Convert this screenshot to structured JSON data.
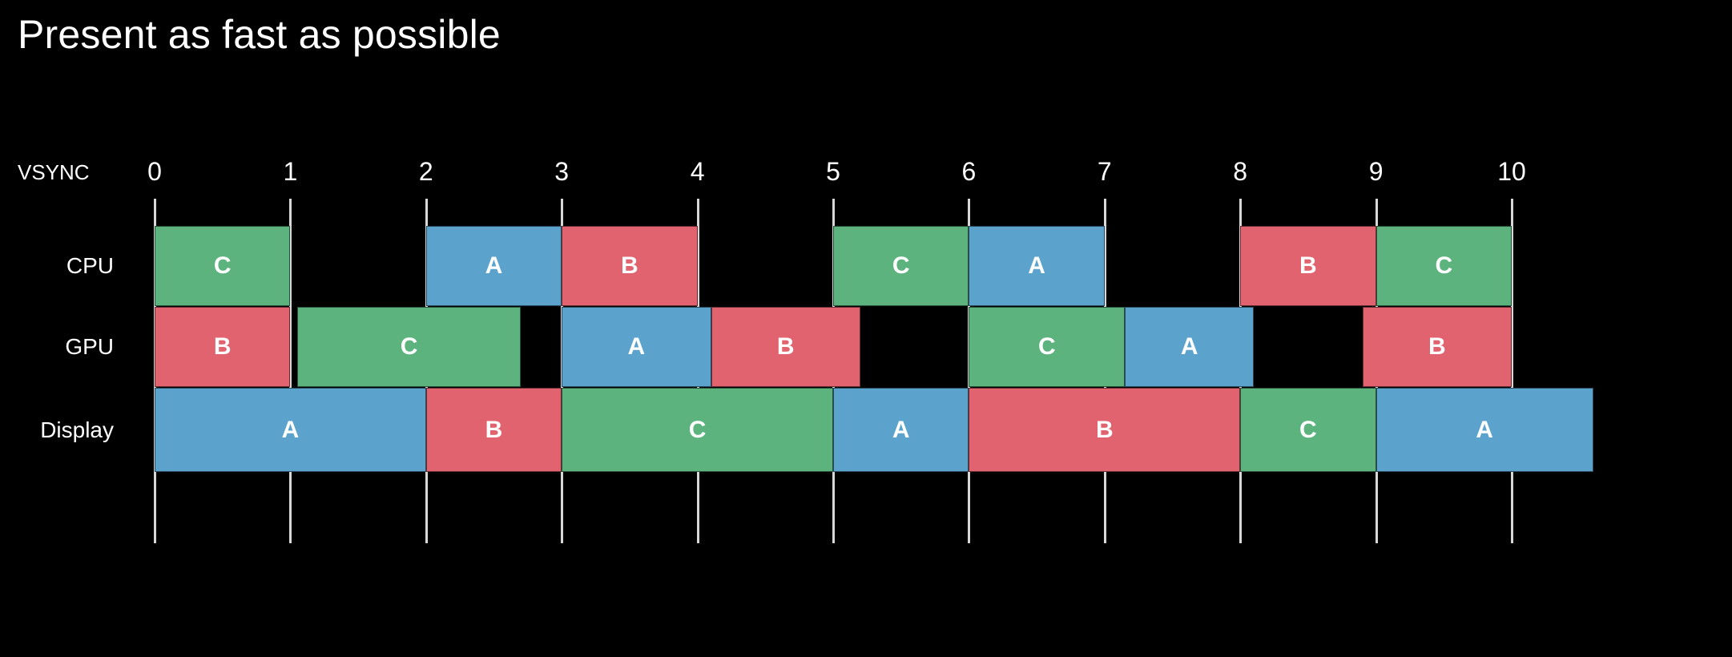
{
  "slide": {
    "title": "Present as fast as possible",
    "background_color": "#000000",
    "text_color": "#ffffff"
  },
  "axis": {
    "caption": "VSYNC",
    "ticks": [
      "0",
      "1",
      "2",
      "3",
      "4",
      "5",
      "6",
      "7",
      "8",
      "9",
      "10"
    ]
  },
  "colors": {
    "frame_a": "#5BA3CC",
    "frame_b": "#E0636F",
    "frame_c": "#5CB37E",
    "tick": "#d8d8d8"
  },
  "rows": [
    {
      "label": "CPU"
    },
    {
      "label": "GPU"
    },
    {
      "label": "Display"
    }
  ],
  "chart_data": {
    "type": "bar",
    "title": "Present as fast as possible",
    "xlabel": "VSYNC",
    "ylabel": "",
    "xlim": [
      0,
      10
    ],
    "categories": [
      "CPU",
      "GPU",
      "Display"
    ],
    "tick_labels": [
      "0",
      "1",
      "2",
      "3",
      "4",
      "5",
      "6",
      "7",
      "8",
      "9",
      "10"
    ],
    "grid": false,
    "legend": "none",
    "series": [
      {
        "name": "CPU",
        "bars": [
          {
            "label": "C",
            "start": 0.0,
            "end": 1.0,
            "color": "#5CB37E"
          },
          {
            "label": "A",
            "start": 2.0,
            "end": 3.0,
            "color": "#5BA3CC"
          },
          {
            "label": "B",
            "start": 3.0,
            "end": 4.0,
            "color": "#E0636F"
          },
          {
            "label": "C",
            "start": 5.0,
            "end": 6.0,
            "color": "#5CB37E"
          },
          {
            "label": "A",
            "start": 6.0,
            "end": 7.0,
            "color": "#5BA3CC"
          },
          {
            "label": "B",
            "start": 8.0,
            "end": 9.0,
            "color": "#E0636F"
          },
          {
            "label": "C",
            "start": 9.0,
            "end": 10.0,
            "color": "#5CB37E"
          }
        ]
      },
      {
        "name": "GPU",
        "bars": [
          {
            "label": "B",
            "start": 0.0,
            "end": 1.0,
            "color": "#E0636F"
          },
          {
            "label": "C",
            "start": 1.05,
            "end": 2.7,
            "color": "#5CB37E"
          },
          {
            "label": "A",
            "start": 3.0,
            "end": 4.1,
            "color": "#5BA3CC"
          },
          {
            "label": "B",
            "start": 4.1,
            "end": 5.2,
            "color": "#E0636F"
          },
          {
            "label": "C",
            "start": 6.0,
            "end": 7.15,
            "color": "#5CB37E"
          },
          {
            "label": "A",
            "start": 7.15,
            "end": 8.1,
            "color": "#5BA3CC"
          },
          {
            "label": "B",
            "start": 8.9,
            "end": 10.0,
            "color": "#E0636F"
          }
        ]
      },
      {
        "name": "Display",
        "bars": [
          {
            "label": "A",
            "start": 0.0,
            "end": 2.0,
            "color": "#5BA3CC"
          },
          {
            "label": "B",
            "start": 2.0,
            "end": 3.0,
            "color": "#E0636F"
          },
          {
            "label": "C",
            "start": 3.0,
            "end": 5.0,
            "color": "#5CB37E"
          },
          {
            "label": "A",
            "start": 5.0,
            "end": 6.0,
            "color": "#5BA3CC"
          },
          {
            "label": "B",
            "start": 6.0,
            "end": 8.0,
            "color": "#E0636F"
          },
          {
            "label": "C",
            "start": 8.0,
            "end": 9.0,
            "color": "#5CB37E"
          },
          {
            "label": "A",
            "start": 9.0,
            "end": 10.6,
            "color": "#5BA3CC"
          }
        ]
      }
    ]
  }
}
